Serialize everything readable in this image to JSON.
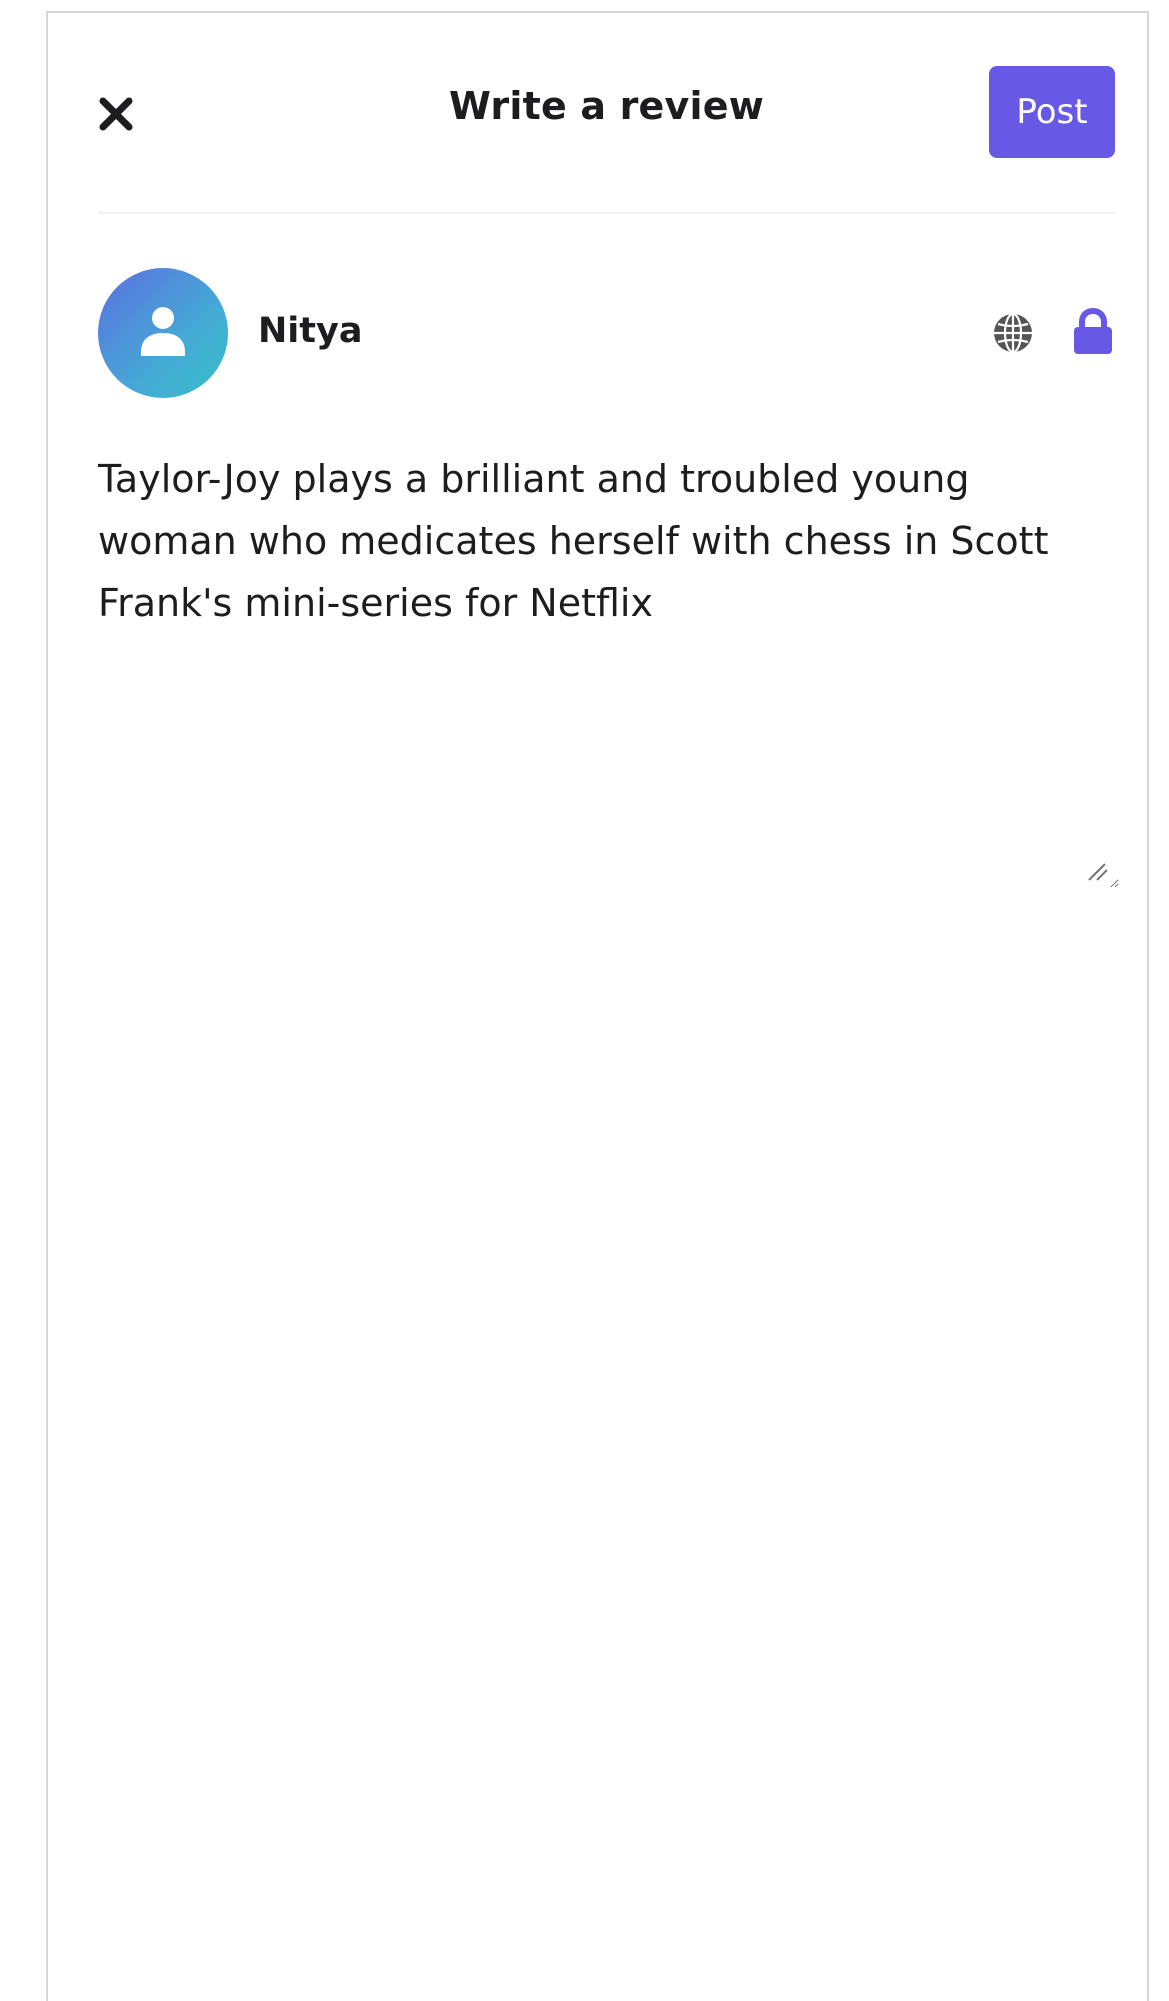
{
  "header": {
    "close_icon": "close-icon",
    "title": "Write a review",
    "post_label": "Post"
  },
  "author": {
    "avatar_icon": "user-icon",
    "name": "Nitya",
    "visibility_icon": "globe-icon",
    "privacy_icon": "lock-icon"
  },
  "review": {
    "text": "Taylor-Joy plays a brilliant and troubled young woman who medicates herself with chess in Scott Frank's mini-series for Netflix"
  },
  "colors": {
    "accent": "#6759e6",
    "text": "#1d1d1f",
    "muted_icon": "#555555",
    "avatar_gradient_start": "#5b6fe0",
    "avatar_gradient_end": "#35c0c8",
    "border": "#d6d6da"
  }
}
